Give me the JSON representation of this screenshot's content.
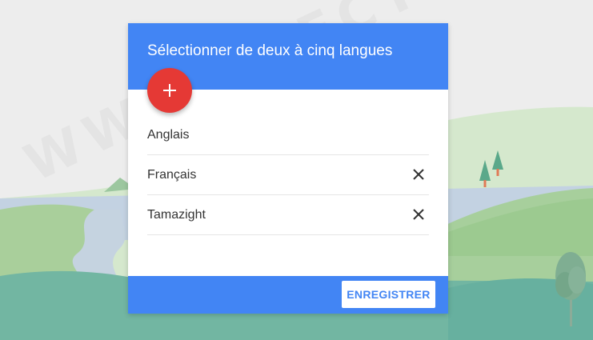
{
  "dialog": {
    "title": "Sélectionner de deux à cinq langues",
    "add_icon": "plus-icon",
    "languages": [
      {
        "label": "Anglais",
        "removable": false
      },
      {
        "label": "Français",
        "removable": true,
        "remove_icon": "close-icon"
      },
      {
        "label": "Tamazight",
        "removable": true,
        "remove_icon": "close-icon"
      }
    ],
    "save_label": "ENREGISTRER"
  },
  "watermark": "WWW.ELECTRODZ.COM",
  "colors": {
    "header": "#4285f4",
    "footer": "#4285f4",
    "fab": "#e53935",
    "save_text": "#4285f4",
    "background": "#ededed"
  }
}
